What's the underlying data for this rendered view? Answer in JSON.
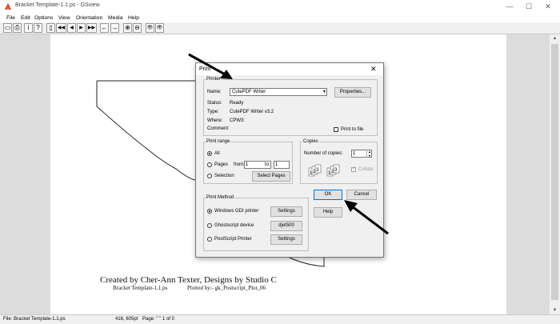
{
  "window": {
    "title": "Bracket Template-1.1.ps - GSview",
    "controls": [
      "—",
      "☐",
      "✕"
    ]
  },
  "menu": [
    "File",
    "Edit",
    "Options",
    "View",
    "Orientation",
    "Media",
    "Help"
  ],
  "toolbar": {
    "buttons": [
      "open-icon",
      "print-icon",
      "info-icon",
      "help-icon",
      "page-icon",
      "first-page-icon",
      "prev-page-icon",
      "next-page-icon",
      "last-page-icon",
      "back-icon",
      "forward-icon",
      "zoom-in-icon",
      "zoom-out-icon",
      "view-icon",
      "view-alt-icon"
    ],
    "glyphs": [
      "▭",
      "⎙",
      "i",
      "?",
      "▯",
      "◀◀",
      "◀",
      "▶",
      "▶▶",
      "←",
      "→",
      "⊕",
      "⊖",
      "👁",
      "👁"
    ]
  },
  "document": {
    "credit": "Created by Cher-Ann Texter, Designs by Studio C",
    "file": "Bracket Template-1,1.ps",
    "plotted": "Plotted by:- gk_Postscript_Plot_06"
  },
  "status": {
    "file": "File: Bracket Template-1.1.ps",
    "coords": "416, 605pt",
    "page": "Page: \" \" 1 of 0"
  },
  "dialog": {
    "title": "Print",
    "close": "✕",
    "printer": {
      "legend": "Printer",
      "name_label": "Name:",
      "name_value": "CutePDF Writer",
      "properties": "Properties...",
      "status_label": "Status:",
      "status_value": "Ready",
      "type_label": "Type:",
      "type_value": "CutePDF Writer v3.2",
      "where_label": "Where:",
      "where_value": "CPW3:",
      "comment_label": "Comment:",
      "print_to_file": "Print to file"
    },
    "range": {
      "legend": "Print range",
      "all": "All",
      "pages": "Pages",
      "from_label": "from:",
      "from_value": "1",
      "to_label": "to:",
      "to_value": "1",
      "selection": "Selection",
      "select_pages": "Select Pages"
    },
    "copies": {
      "legend": "Copies",
      "number_label": "Number of copies:",
      "number_value": "1",
      "collate": "Collate"
    },
    "ok": "OK",
    "cancel": "Cancel",
    "help": "Help",
    "method": {
      "legend": "Print Method",
      "windows_gdi": "Windows GDI printer",
      "settings1": "Settings",
      "ghostscript": "Ghostscript device",
      "device": "djet500",
      "postscript": "PostScript Printer",
      "settings2": "Settings"
    }
  },
  "colors": {
    "accent": "#0078d7",
    "page_bg": "#dcdcdc"
  }
}
